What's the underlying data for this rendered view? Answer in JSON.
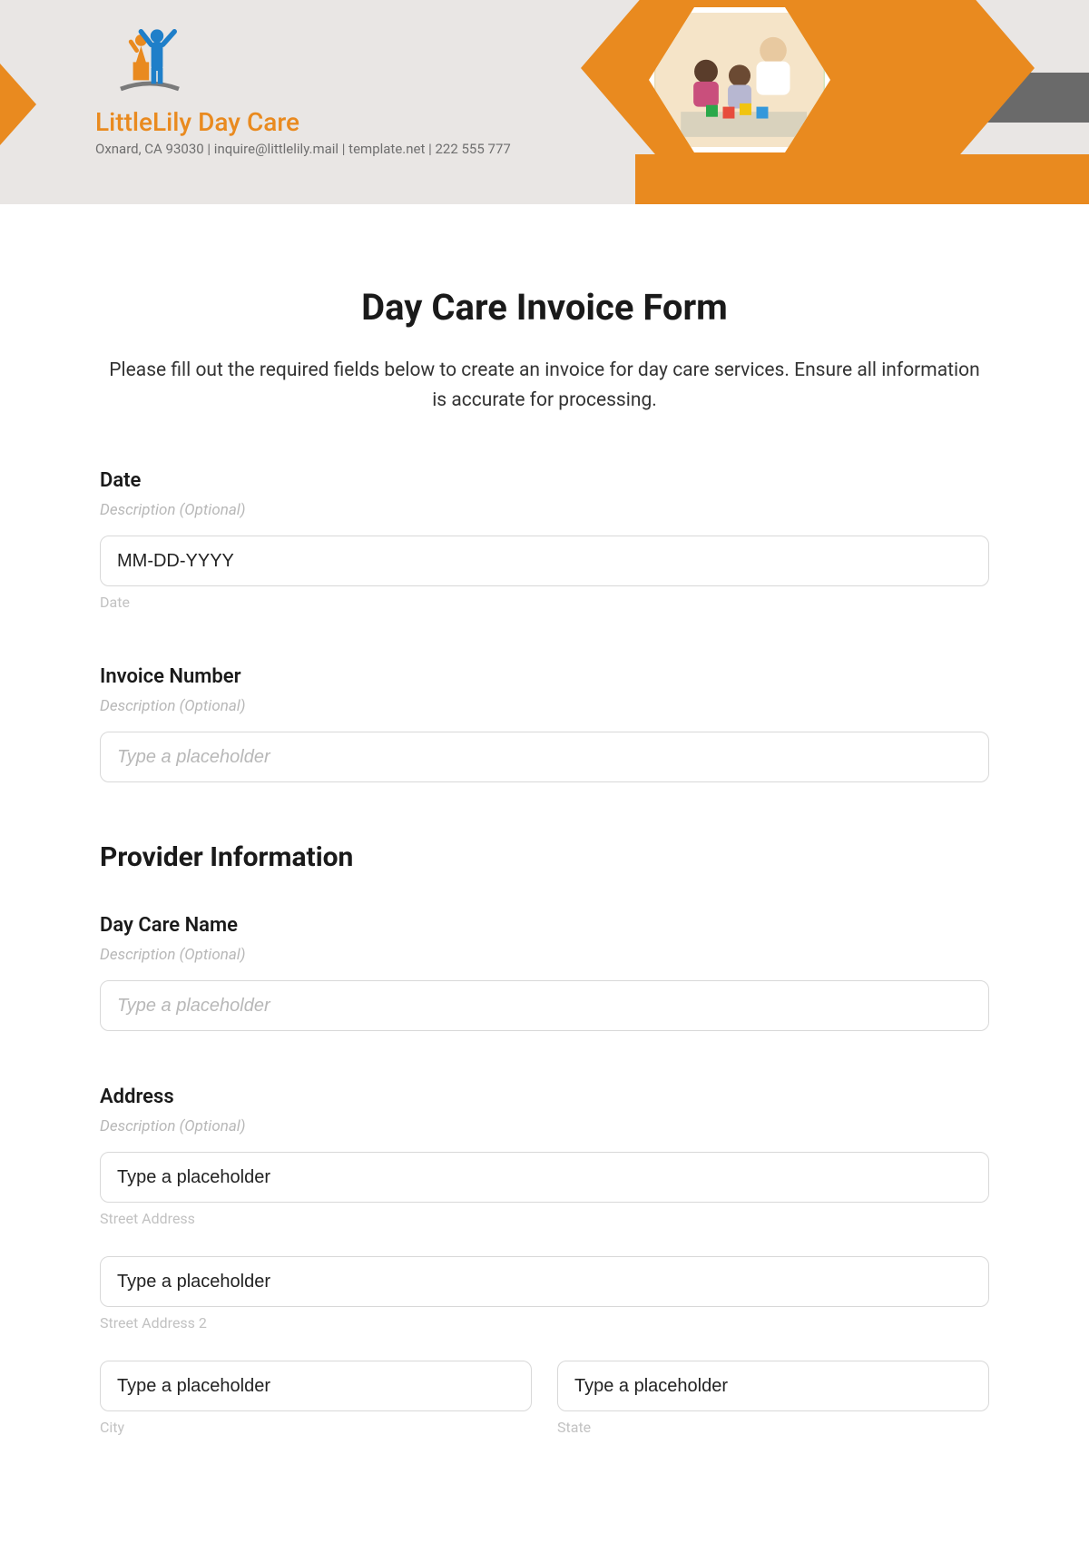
{
  "brand": {
    "name": "LittleLily Day Care",
    "tagline": "Oxnard, CA 93030 | inquire@littlelily.mail | template.net | 222 555 777"
  },
  "form": {
    "title": "Day Care Invoice Form",
    "description": "Please fill out the required fields below to create an invoice for day care services. Ensure all information is accurate for processing.",
    "fields": {
      "date": {
        "label": "Date",
        "hint": "Description (Optional)",
        "placeholder": "MM-DD-YYYY",
        "sublabel": "Date"
      },
      "invoice_number": {
        "label": "Invoice Number",
        "hint": "Description (Optional)",
        "placeholder": "Type a placeholder"
      }
    },
    "provider_section": {
      "heading": "Provider Information",
      "daycare_name": {
        "label": "Day Care Name",
        "hint": "Description (Optional)",
        "placeholder": "Type a placeholder"
      },
      "address": {
        "label": "Address",
        "hint": "Description (Optional)",
        "street1_placeholder": "Type a placeholder",
        "street1_sublabel": "Street Address",
        "street2_placeholder": "Type a placeholder",
        "street2_sublabel": "Street Address 2",
        "city_placeholder": "Type a placeholder",
        "city_sublabel": "City",
        "state_placeholder": "Type a placeholder",
        "state_sublabel": "State"
      }
    }
  }
}
